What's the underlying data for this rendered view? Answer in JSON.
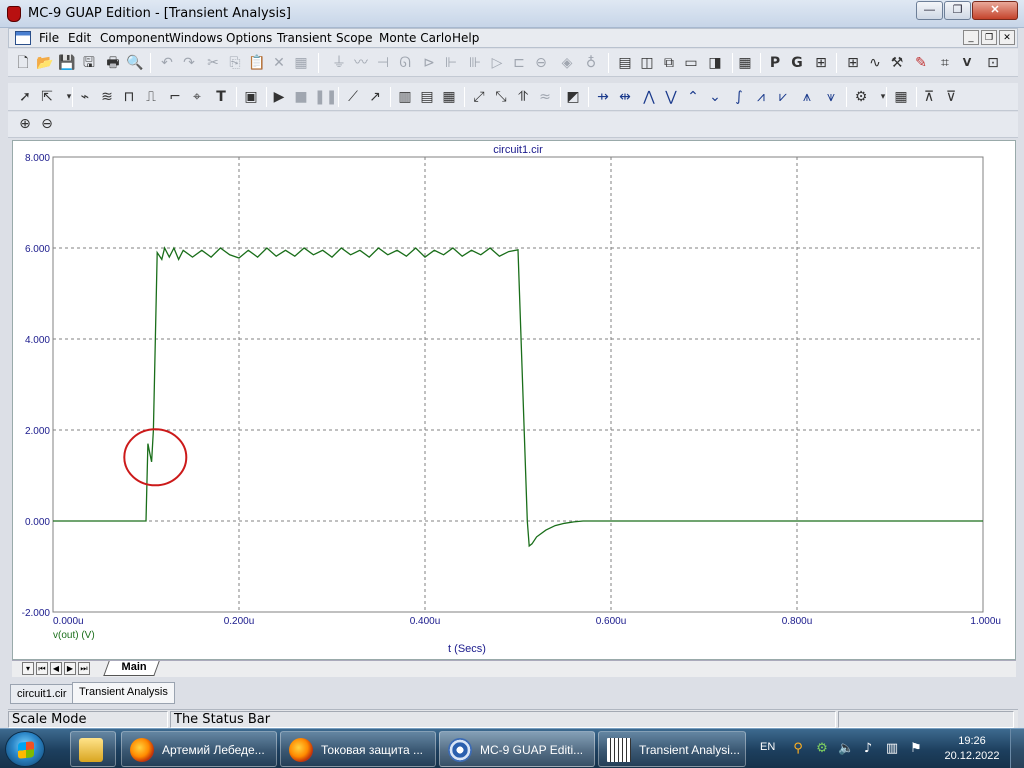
{
  "window": {
    "title": "MC-9 GUAP Edition - [Transient Analysis]",
    "controls": [
      "minimize-icon",
      "restore-icon",
      "close-icon"
    ]
  },
  "menu": [
    "File",
    "Edit",
    "Component",
    "Windows",
    "Options",
    "Transient",
    "Scope",
    "Monte Carlo",
    "Help"
  ],
  "plot": {
    "title": "circuit1.cir",
    "xlabel": "t (Secs)",
    "trace_label": "v(out) (V)",
    "trace_color": "#1a6e1a",
    "grid_color": "#808080",
    "axis_text_color": "#1a1a8c",
    "annotation_color": "#cc1a1a"
  },
  "chart_data": {
    "type": "line",
    "title": "circuit1.cir",
    "xlabel": "t (Secs)",
    "ylabel": "",
    "x_unit": "u",
    "xlim": [
      0,
      1.0
    ],
    "ylim": [
      -2.0,
      8.0
    ],
    "x_ticks": [
      "0.000u",
      "0.200u",
      "0.400u",
      "0.600u",
      "0.800u",
      "1.000u"
    ],
    "y_ticks": [
      "-2.000",
      "0.000",
      "2.000",
      "4.000",
      "6.000",
      "8.000"
    ],
    "grid": true,
    "series": [
      {
        "name": "v(out) (V)",
        "x": [
          0.0,
          0.1,
          0.102,
          0.104,
          0.106,
          0.108,
          0.112,
          0.117,
          0.12,
          0.125,
          0.13,
          0.135,
          0.14,
          0.15,
          0.16,
          0.17,
          0.18,
          0.19,
          0.2,
          0.21,
          0.22,
          0.23,
          0.24,
          0.25,
          0.26,
          0.27,
          0.28,
          0.29,
          0.3,
          0.31,
          0.32,
          0.33,
          0.34,
          0.35,
          0.36,
          0.37,
          0.38,
          0.39,
          0.4,
          0.41,
          0.42,
          0.43,
          0.44,
          0.45,
          0.46,
          0.47,
          0.48,
          0.49,
          0.5,
          0.51,
          0.512,
          0.515,
          0.52,
          0.53,
          0.54,
          0.55,
          0.56,
          0.57,
          0.58,
          0.59,
          0.6,
          1.0
        ],
        "y": [
          0.0,
          0.0,
          1.7,
          1.5,
          1.3,
          2.0,
          5.9,
          5.75,
          6.0,
          5.8,
          6.0,
          5.75,
          5.95,
          5.8,
          5.95,
          5.8,
          6.0,
          5.85,
          5.78,
          5.95,
          5.8,
          6.0,
          5.82,
          5.95,
          5.82,
          6.0,
          5.85,
          5.95,
          5.8,
          6.0,
          5.85,
          5.95,
          5.8,
          6.0,
          5.85,
          5.95,
          5.82,
          6.0,
          5.8,
          5.95,
          5.85,
          6.0,
          5.82,
          5.95,
          5.85,
          6.0,
          5.82,
          5.92,
          5.96,
          0.0,
          -0.55,
          -0.5,
          -0.35,
          -0.2,
          -0.1,
          -0.05,
          -0.02,
          0.0,
          0.0,
          0.0,
          0.0,
          0.0
        ]
      }
    ],
    "annotation": {
      "shape": "circle",
      "center_x": 0.11,
      "center_y": 1.4
    }
  },
  "tabs": {
    "sheet_tab": "Main",
    "nav": [
      "first-icon",
      "prev-icon",
      "next-icon",
      "last-icon"
    ]
  },
  "doctabs": [
    "circuit1.cir",
    "Transient Analysis"
  ],
  "status": {
    "mode": "Scale Mode",
    "message": "The Status Bar"
  },
  "taskbar": {
    "items": [
      "Артемий Лебеде...",
      "Токовая защита ...",
      "MC-9 GUAP Editi...",
      "Transient Analysi..."
    ],
    "lang": "EN",
    "time": "19:26",
    "date": "20.12.2022"
  }
}
